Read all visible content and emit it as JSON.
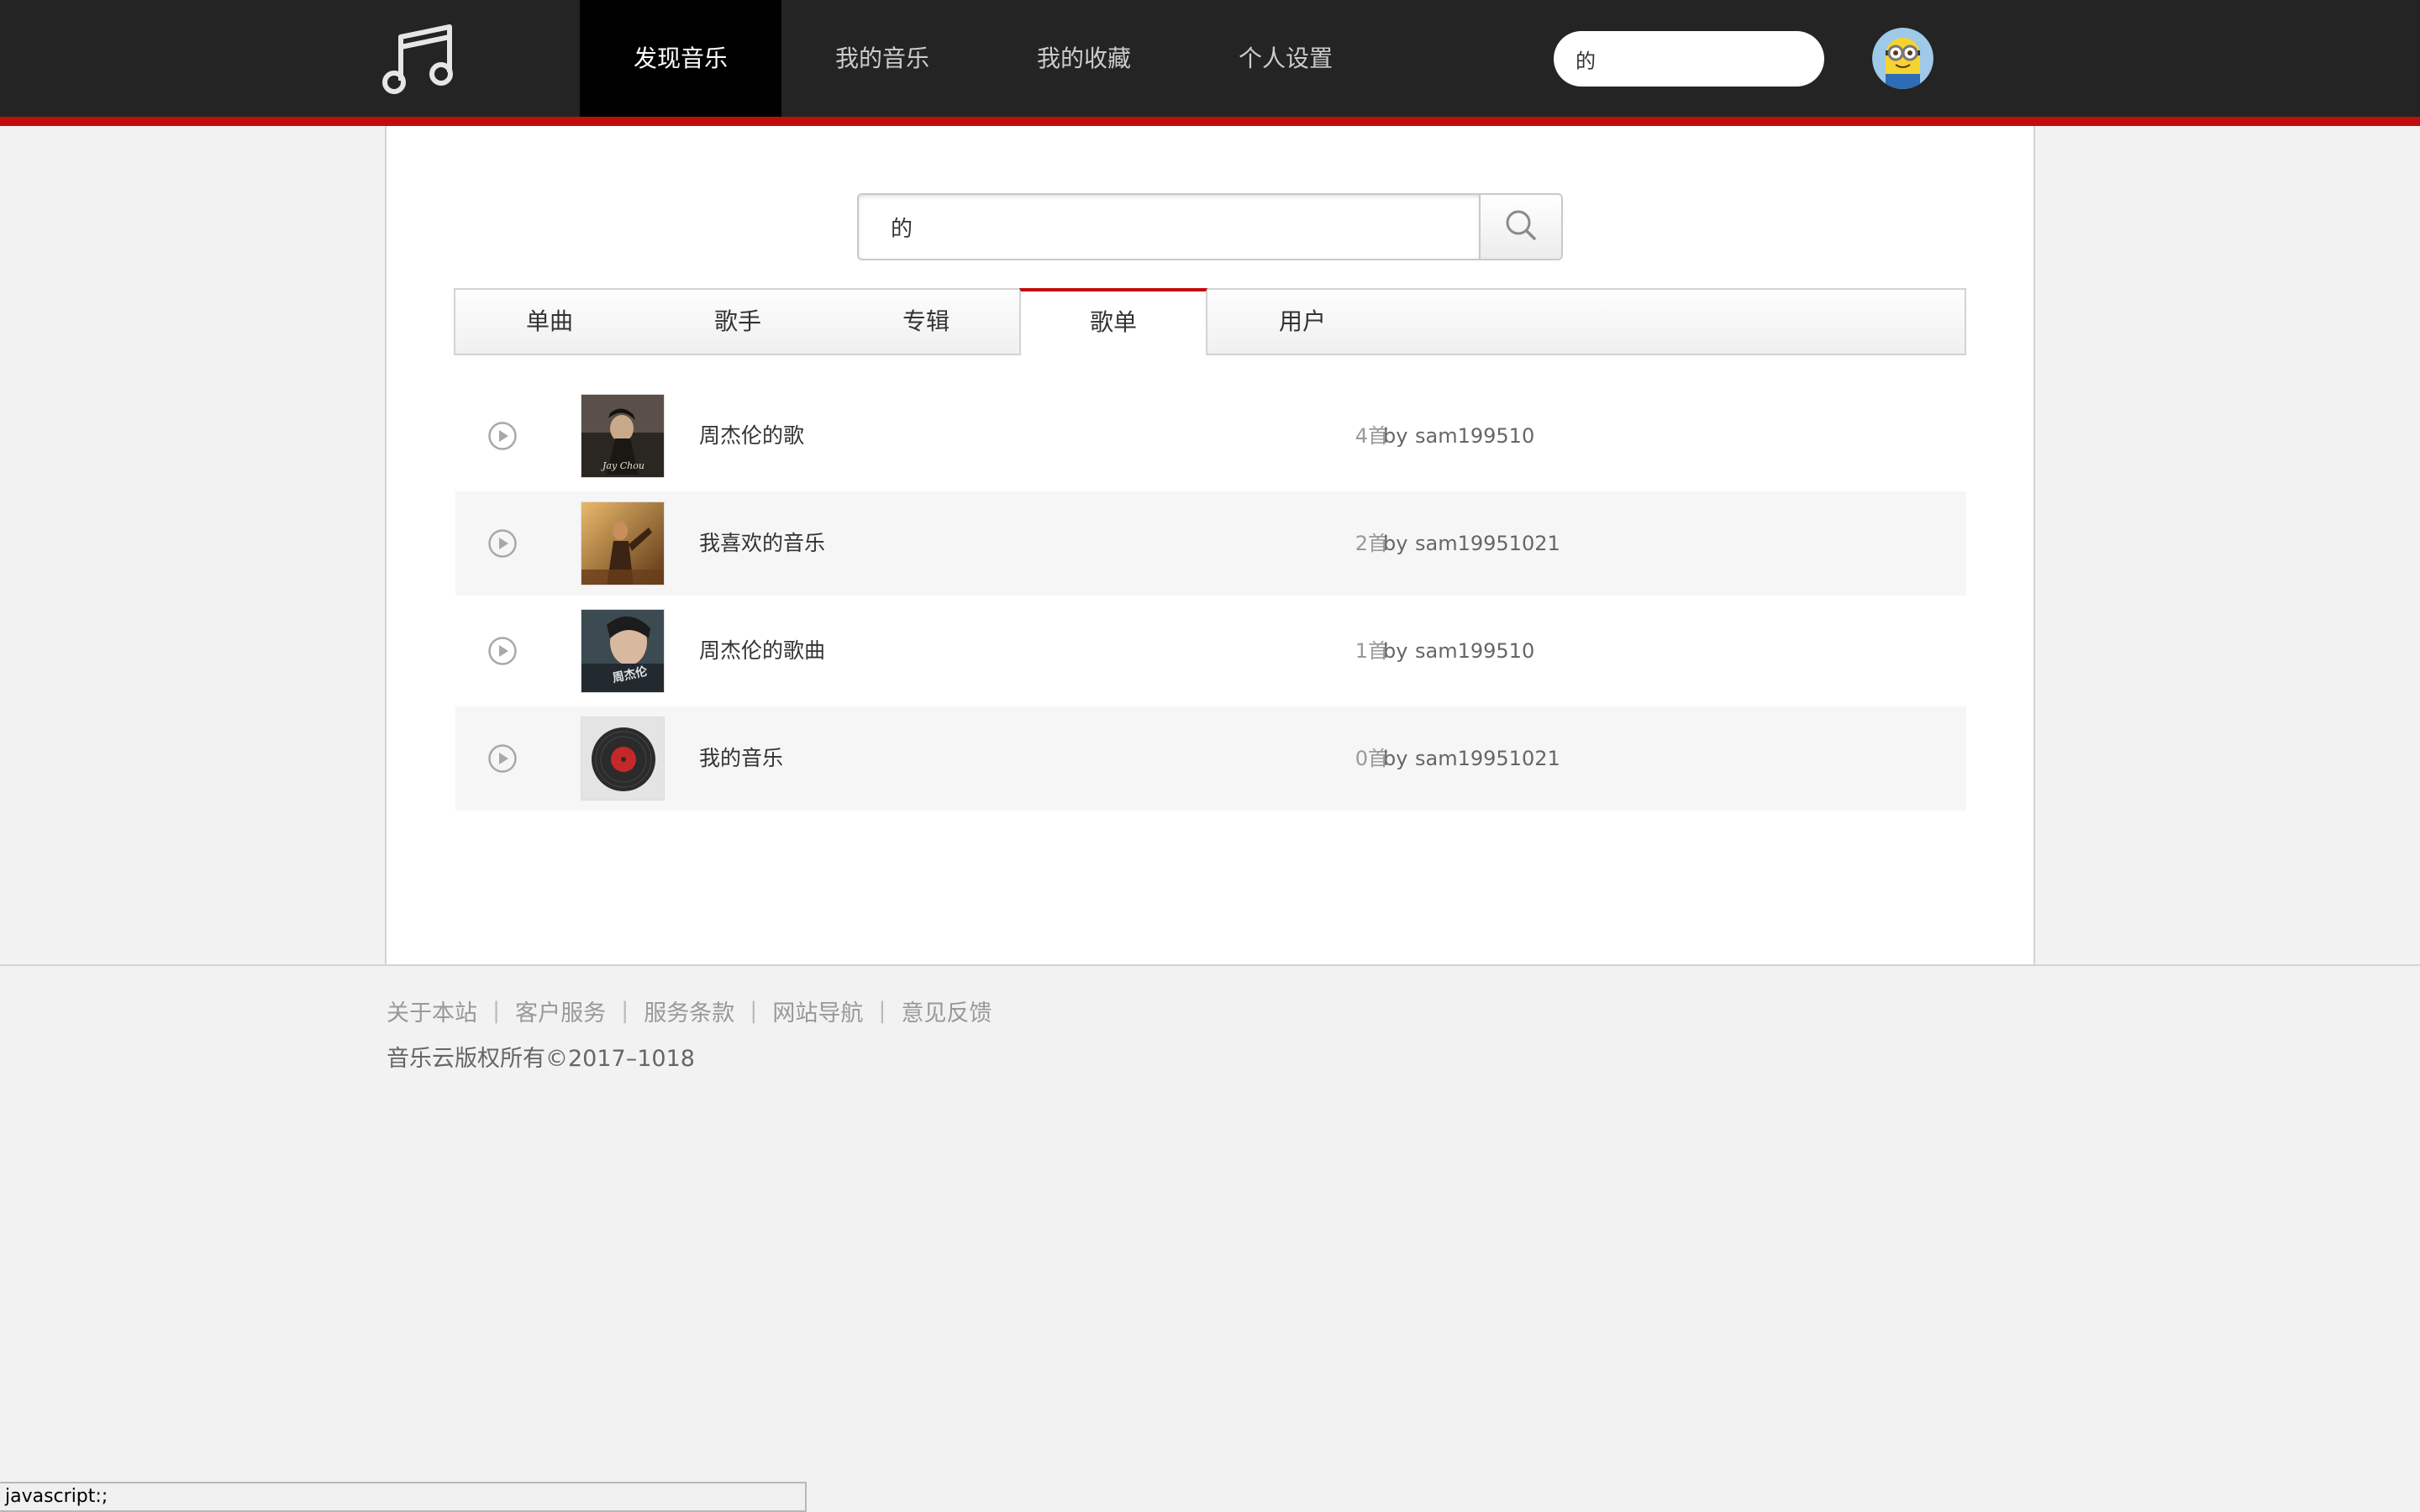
{
  "header": {
    "nav": [
      "发现音乐",
      "我的音乐",
      "我的收藏",
      "个人设置"
    ],
    "active_nav": "发现音乐",
    "search_value": "的"
  },
  "search": {
    "value": "的"
  },
  "tabs": [
    "单曲",
    "歌手",
    "专辑",
    "歌单",
    "用户"
  ],
  "active_tab": "歌单",
  "playlists": [
    {
      "name": "周杰伦的歌",
      "count": "4首",
      "by": "by",
      "user": "sam199510"
    },
    {
      "name": "我喜欢的音乐",
      "count": "2首",
      "by": "by",
      "user": "sam19951021"
    },
    {
      "name": "周杰伦的歌曲",
      "count": "1首",
      "by": "by",
      "user": "sam199510"
    },
    {
      "name": "我的音乐",
      "count": "0首",
      "by": "by",
      "user": "sam19951021"
    }
  ],
  "footer": {
    "links": [
      "关于本站",
      "客户服务",
      "服务条款",
      "网站导航",
      "意见反馈"
    ],
    "copyright": "音乐云版权所有©2017–1018"
  },
  "statusbar": "javascript:;",
  "icons": {
    "logo": "music-note-icon",
    "search": "search-icon",
    "play": "play-circle-icon",
    "avatar": "minion-avatar"
  },
  "colors": {
    "accent": "#c20c0c",
    "topbar": "#242424"
  }
}
